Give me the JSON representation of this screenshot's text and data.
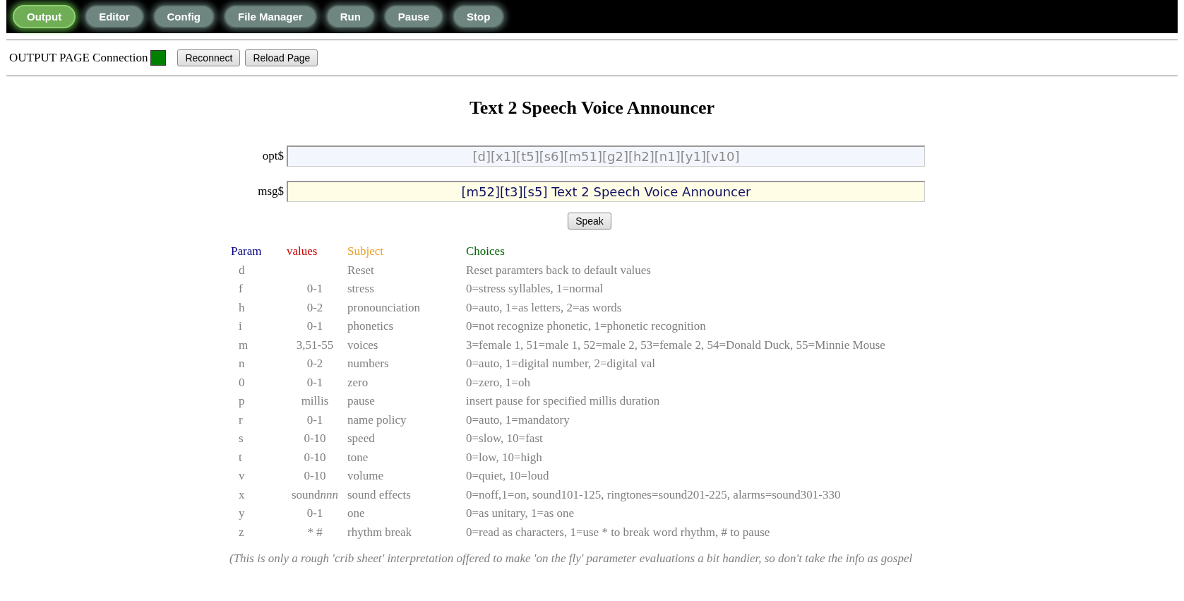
{
  "nav_tabs": [
    {
      "label": "Output",
      "selected": true
    },
    {
      "label": "Editor",
      "selected": false
    },
    {
      "label": "Config",
      "selected": false
    },
    {
      "label": "File Manager",
      "selected": false
    },
    {
      "label": "Run",
      "selected": false
    },
    {
      "label": "Pause",
      "selected": false
    },
    {
      "label": "Stop",
      "selected": false
    }
  ],
  "status": {
    "label": "OUTPUT PAGE Connection",
    "connected": true
  },
  "status_buttons": [
    "Reconnect",
    "Reload Page"
  ],
  "title": "Text 2 Speech Voice Announcer",
  "fields": [
    {
      "label": "opt$",
      "value": "[d][x1][t5][s6][m51][g2][h2][n1][y1][v10]",
      "kind": "options"
    },
    {
      "label": "msg$",
      "value": "[m52][t3][s5] Text 2 Speech Voice Announcer",
      "kind": "message"
    }
  ],
  "speak_button": "Speak",
  "table": {
    "columns": [
      "Param",
      "values",
      "Subject",
      "Choices"
    ],
    "rows": [
      {
        "param": "d",
        "values": "",
        "subject": "Reset",
        "choices": "Reset paramters back to default values"
      },
      {
        "param": "f",
        "values": "0-1",
        "subject": "stress",
        "choices": "0=stress syllables, 1=normal"
      },
      {
        "param": "h",
        "values": "0-2",
        "subject": "pronounciation",
        "choices": "0=auto, 1=as letters, 2=as words"
      },
      {
        "param": "i",
        "values": "0-1",
        "subject": "phonetics",
        "choices": "0=not recognize phonetic, 1=phonetic recognition"
      },
      {
        "param": "m",
        "values": "3,51-55",
        "subject": "voices",
        "choices": "3=female 1, 51=male 1, 52=male 2, 53=female 2, 54=Donald Duck, 55=Minnie Mouse"
      },
      {
        "param": "n",
        "values": "0-2",
        "subject": "numbers",
        "choices": "0=auto, 1=digital number, 2=digital val"
      },
      {
        "param": "0",
        "values": "0-1",
        "subject": "zero",
        "choices": "0=zero, 1=oh"
      },
      {
        "param": "p",
        "values": "millis",
        "subject": "pause",
        "choices": "insert pause for specified millis duration"
      },
      {
        "param": "r",
        "values": "0-1",
        "subject": "name policy",
        "choices": "0=auto, 1=mandatory"
      },
      {
        "param": "s",
        "values": "0-10",
        "subject": "speed",
        "choices": "0=slow, 10=fast"
      },
      {
        "param": "t",
        "values": "0-10",
        "subject": "tone",
        "choices": "0=low, 10=high"
      },
      {
        "param": "v",
        "values": "0-10",
        "subject": "volume",
        "choices": "0=quiet, 10=loud"
      },
      {
        "param": "x",
        "values": "sound",
        "values_italic": "nnn",
        "subject": "sound effects",
        "choices": "0=noff,1=on, sound101-125, ringtones=sound201-225, alarms=sound301-330"
      },
      {
        "param": "y",
        "values": "0-1",
        "subject": "one",
        "choices": "0=as unitary, 1=as one"
      },
      {
        "param": "z",
        "values": "* #",
        "subject": "rhythm break",
        "choices": "0=read as characters, 1=use * to break word rhythm, # to pause"
      }
    ]
  },
  "footnote": "(This is only a rough 'crib sheet' interpretation offered to make 'on the fly' parameter evaluations a bit handier, so don't take the info as gospel"
}
